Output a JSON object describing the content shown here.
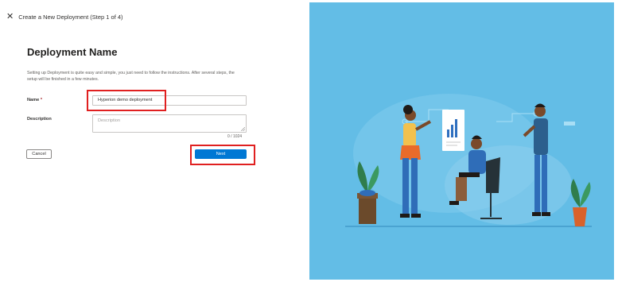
{
  "header": {
    "close_icon": "close-icon",
    "title": "Create a New Deployment (Step 1 of 4)"
  },
  "form": {
    "heading": "Deployment Name",
    "description": "Setting up Deployment is quite easy and simple, you just need to follow the instructions. After several steps, the setup will be finished in a few minutes.",
    "name_label": "Name",
    "required_mark": "*",
    "name_value": "Hyperion demo deployment",
    "description_label": "Description",
    "description_placeholder": "Description",
    "char_counter": "0 / 1024"
  },
  "buttons": {
    "cancel": "Cancel",
    "next": "Next"
  },
  "colors": {
    "accent": "#0078d4",
    "highlight": "#e02020",
    "illustration_bg": "#63bde6"
  },
  "illustration": {
    "subject": "team-collaboration-illustration"
  }
}
